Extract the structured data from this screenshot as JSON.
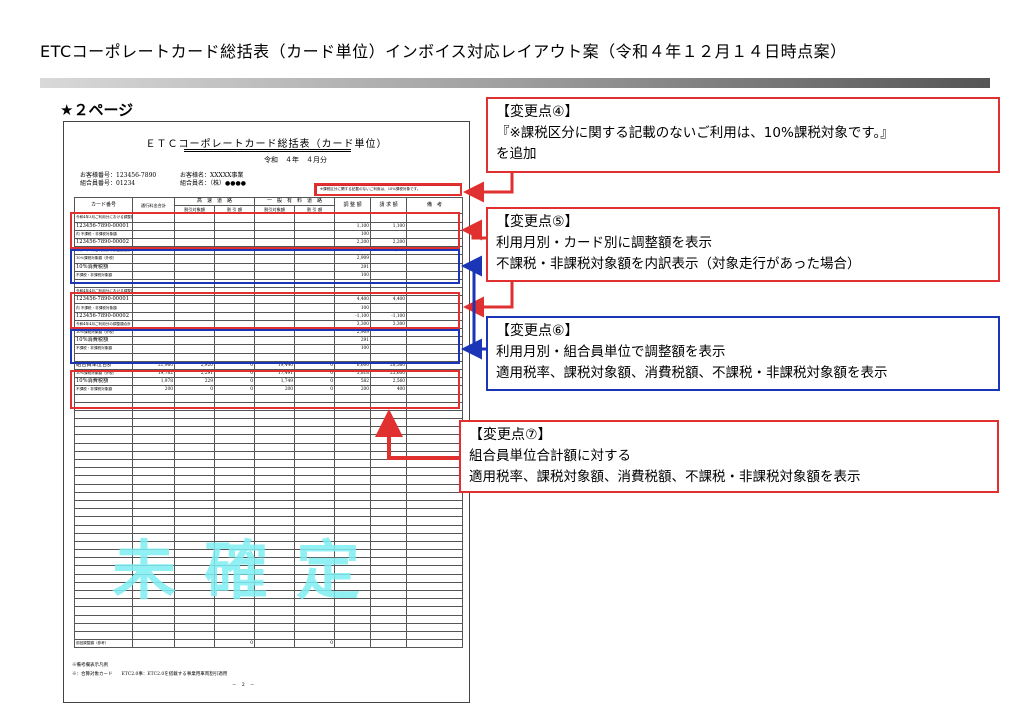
{
  "slide": {
    "title": "ETCコーポレートカード総括表（カード単位）インボイス対応レイアウト案（令和４年１２月１４日時点案）",
    "page_label": "★２ページ"
  },
  "doc": {
    "title": "ＥＴＣコーポレートカード総括表（カード単位）",
    "date": "令和　４年　４月分",
    "customer_no": "お客様番号：123456-7890",
    "customer_name": "お客様名：XXXXX事業",
    "union_no": "組合員番号：01234",
    "union_name": "組合員名：（株）●●●●",
    "notice": "※課税区分に関する記載のないご利用は、10%課税対象です。",
    "header": {
      "card_no": "カード番号",
      "toll_total": "通行料金合計",
      "expressway": "高　速　道　路",
      "general": "一　般　有　料　道　路",
      "adjust": "調 整 額",
      "billing": "請 求 額",
      "remarks": "備　考",
      "discount_target": "割引対象額",
      "discount": "割 引 額"
    },
    "rows": [
      [
        "令和4年3月ご利用分における調整額",
        "",
        "",
        "",
        "",
        "",
        "",
        "",
        ""
      ],
      [
        "123456-7890-00001",
        "",
        "",
        "",
        "",
        "",
        "1,100",
        "1,100",
        ""
      ],
      [
        "内 不課税・非課税対象額",
        "",
        "",
        "",
        "",
        "",
        "100",
        "",
        ""
      ],
      [
        "123456-7890-00002",
        "",
        "",
        "",
        "",
        "",
        "2,200",
        "2,200",
        ""
      ],
      [
        "令和4年3月ご利用分の調整額合計",
        "",
        "",
        "",
        "",
        "",
        "3,300",
        "3,300",
        ""
      ],
      [
        "10%課税対象額（外税）",
        "",
        "",
        "",
        "",
        "",
        "2,909",
        "",
        ""
      ],
      [
        "10%消費税額",
        "",
        "",
        "",
        "",
        "",
        "291",
        "",
        ""
      ],
      [
        "不課税・非課税対象額",
        "",
        "",
        "",
        "",
        "",
        "100",
        "",
        ""
      ],
      [
        "",
        "",
        "",
        "",
        "",
        "",
        "",
        "",
        ""
      ],
      [
        "令和4年4月ご利用分における調整額",
        "",
        "",
        "",
        "",
        "",
        "",
        "",
        ""
      ],
      [
        "123456-7890-00001",
        "",
        "",
        "",
        "",
        "",
        "4,400",
        "4,400",
        ""
      ],
      [
        "内 不課税・非課税対象額",
        "",
        "",
        "",
        "",
        "",
        "100",
        "",
        ""
      ],
      [
        "123456-7890-00002",
        "",
        "",
        "",
        "",
        "",
        "-1,100",
        "-1,100",
        ""
      ],
      [
        "令和4年4月ご利用分の調整額合計",
        "",
        "",
        "",
        "",
        "",
        "3,300",
        "3,300",
        ""
      ],
      [
        "10%課税対象額（外税）",
        "",
        "",
        "",
        "",
        "",
        "2,909",
        "",
        ""
      ],
      [
        "10%消費税額",
        "",
        "",
        "",
        "",
        "",
        "291",
        "",
        ""
      ],
      [
        "不課税・非課税対象額",
        "",
        "",
        "",
        "",
        "",
        "100",
        "",
        ""
      ],
      [
        "",
        "",
        "",
        "",
        "",
        "",
        "",
        "",
        ""
      ],
      [
        "組合員単位合計",
        "21,960",
        "2,920",
        "0",
        "19,440",
        "0",
        "6,600",
        "28,560",
        ""
      ],
      [
        "10%課税対象額（外税）",
        "19,782",
        "2,291",
        "0",
        "17,491",
        "0",
        "5,818",
        "25,600",
        ""
      ],
      [
        "10%消費税額",
        "1,978",
        "229",
        "0",
        "1,749",
        "0",
        "582",
        "2,560",
        ""
      ],
      [
        "不課税・非課税対象額",
        "200",
        "0",
        "0",
        "200",
        "0",
        "200",
        "400",
        ""
      ]
    ],
    "footer_row": [
      "前回調整額（参考）",
      "",
      "",
      "0",
      "",
      "0",
      "",
      "",
      ""
    ],
    "footnote1": "※備考欄表示凡例",
    "footnote2": "※：合算対象カード　　ETC2.0事：ETC2.0を搭載する事業用車両割引適用",
    "page_number": "－　２　－",
    "watermark": "未確定"
  },
  "callouts": {
    "c4": {
      "title": "【変更点④】",
      "lines": [
        "『※課税区分に関する記載のないご利用は、10%課税対象です。』",
        "を追加"
      ]
    },
    "c5": {
      "title": "【変更点⑤】",
      "lines": [
        "利用月別・カード別に調整額を表示",
        "不課税・非課税対象額を内訳表示（対象走行があった場合）"
      ]
    },
    "c6": {
      "title": "【変更点⑥】",
      "lines": [
        "利用月別・組合員単位で調整額を表示",
        "適用税率、課税対象額、消費税額、不課税・非課税対象額を表示"
      ]
    },
    "c7": {
      "title": "【変更点⑦】",
      "lines": [
        "組合員単位合計額に対する",
        "適用税率、課税対象額、消費税額、不課税・非課税対象額を表示"
      ]
    }
  },
  "colors": {
    "red": "#e03030",
    "blue": "#1a35b5",
    "watermark": "#7eeef2"
  }
}
